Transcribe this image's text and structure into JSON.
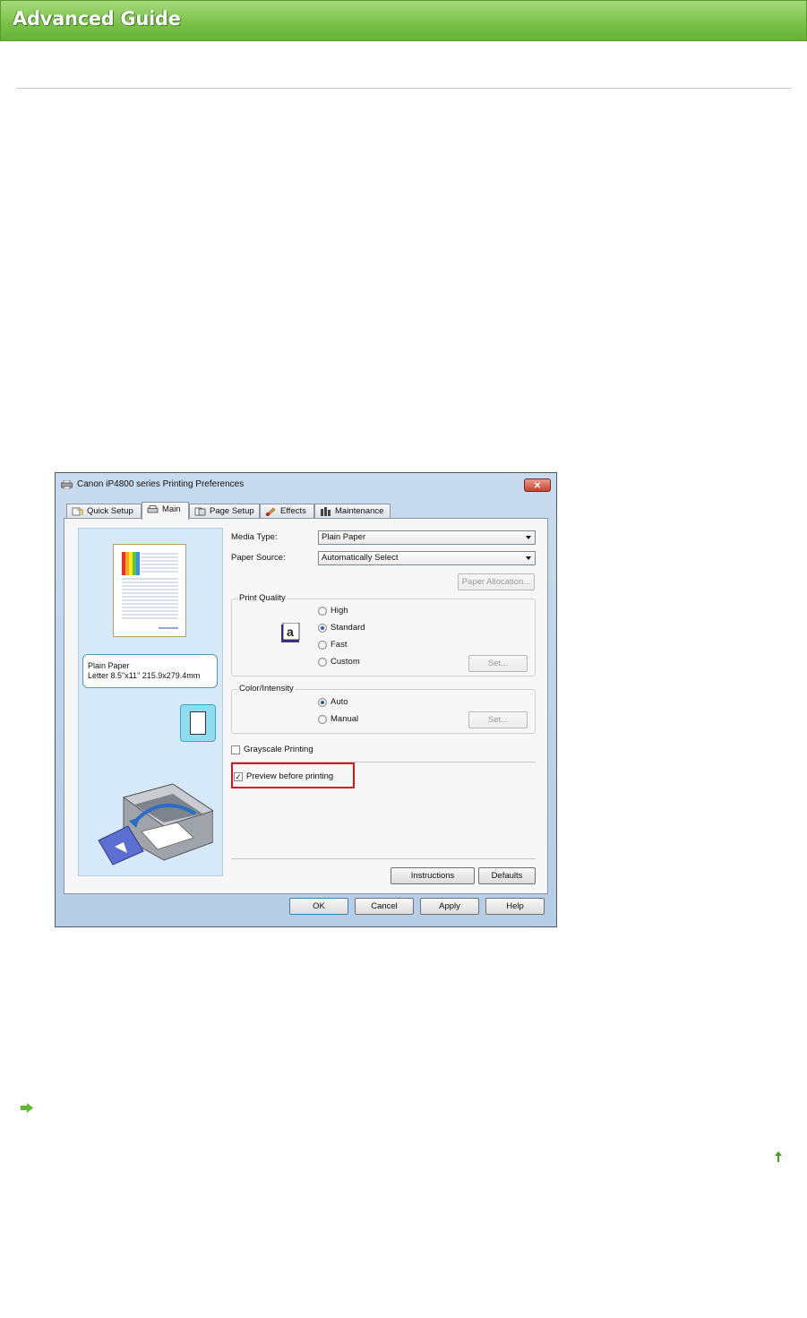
{
  "header": {
    "title": "Advanced Guide"
  },
  "dialog": {
    "title": "Canon iP4800 series Printing Preferences",
    "close_label": "✕",
    "tabs": [
      {
        "label": "Quick Setup",
        "icon": "quick-setup-icon",
        "active": false
      },
      {
        "label": "Main",
        "icon": "main-icon",
        "active": true
      },
      {
        "label": "Page Setup",
        "icon": "page-setup-icon",
        "active": false
      },
      {
        "label": "Effects",
        "icon": "effects-icon",
        "active": false
      },
      {
        "label": "Maintenance",
        "icon": "maintenance-icon",
        "active": false
      }
    ],
    "paper_info": {
      "line1": "Plain Paper",
      "line2": "Letter 8.5\"x11\" 215.9x279.4mm"
    },
    "media_type": {
      "label": "Media Type:",
      "value": "Plain Paper"
    },
    "paper_source": {
      "label": "Paper Source:",
      "value": "Automatically Select"
    },
    "paper_allocation": "Paper Allocation...",
    "print_quality": {
      "title": "Print Quality",
      "options": [
        "High",
        "Standard",
        "Fast",
        "Custom"
      ],
      "selected": "Standard",
      "set_label": "Set..."
    },
    "color_intensity": {
      "title": "Color/Intensity",
      "options": [
        "Auto",
        "Manual"
      ],
      "selected": "Auto",
      "set_label": "Set..."
    },
    "grayscale": {
      "label": "Grayscale Printing",
      "checked": false
    },
    "preview": {
      "label": "Preview before printing",
      "checked": true,
      "check_mark": "✓"
    },
    "instructions": "Instructions",
    "defaults": "Defaults",
    "buttons": {
      "ok": "OK",
      "cancel": "Cancel",
      "apply": "Apply",
      "help": "Help"
    }
  },
  "colors": {
    "banner": "#7cc24a",
    "highlight": "#d9141c",
    "link_arrow": "#5fb832"
  }
}
